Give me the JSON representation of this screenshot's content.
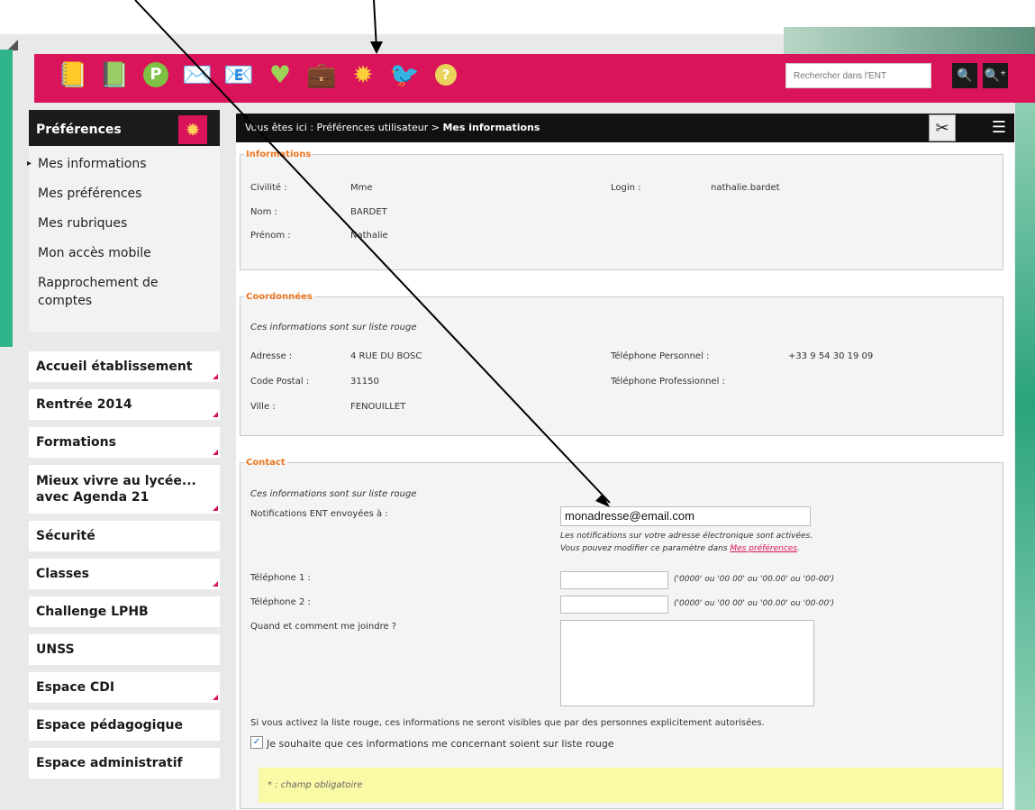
{
  "topbar": {
    "icons": [
      "notepad-icon",
      "book-icon",
      "p-icon",
      "mail-icon",
      "at-icon",
      "heart-icon",
      "briefcase-icon",
      "gear-icon",
      "bird-icon",
      "help-icon"
    ],
    "search_placeholder": "Rechercher dans l'ENT",
    "search_glyph": "🔍",
    "advanced_glyph": "🔍⁺"
  },
  "sidebar": {
    "pref_title": "Préférences",
    "pref_items": [
      "Mes informations",
      "Mes préférences",
      "Mes rubriques",
      "Mon accès mobile",
      "Rapprochement de comptes"
    ],
    "nav_items": [
      "Accueil établissement",
      "Rentrée 2014",
      "Formations",
      "Mieux vivre au lycée... avec Agenda 21",
      "Sécurité",
      "Classes",
      "Challenge LPHB",
      "UNSS",
      "Espace CDI",
      "Espace pédagogique",
      "Espace administratif"
    ]
  },
  "breadcrumb": {
    "prefix": "Vous êtes ici : Préférences utilisateur > ",
    "current": "Mes informations"
  },
  "informations": {
    "legend": "Informations",
    "civilite_label": "Civilité :",
    "civilite": "Mme",
    "nom_label": "Nom :",
    "nom": "BARDET",
    "prenom_label": "Prénom :",
    "prenom": "Nathalie",
    "login_label": "Login :",
    "login": "nathalie.bardet"
  },
  "coordonnees": {
    "legend": "Coordonnées",
    "note": "Ces informations sont sur liste rouge",
    "adresse_label": "Adresse :",
    "adresse": "4 RUE DU BOSC",
    "cp_label": "Code Postal :",
    "cp": "31150",
    "ville_label": "Ville :",
    "ville": "FENOUILLET",
    "tel_perso_label": "Téléphone Personnel :",
    "tel_perso": "+33 9 54 30 19 09",
    "tel_pro_label": "Téléphone Professionnel :"
  },
  "contact": {
    "legend": "Contact",
    "note": "Ces informations sont sur liste rouge",
    "notif_label": "Notifications ENT envoyées à :",
    "email": "monadresse@email.com",
    "notif_hint1": "Les notifications sur votre adresse électronique sont activées.",
    "notif_hint2_prefix": "Vous pouvez modifier ce paramètre dans ",
    "notif_hint2_link": "Mes préférences",
    "notif_hint2_suffix": ".",
    "tel1_label": "Téléphone 1 :",
    "tel2_label": "Téléphone 2 :",
    "tel_format": "('0000' ou '00 00' ou '00.00' ou '00-00')",
    "joindre_label": "Quand et comment me joindre ?",
    "liste_rouge_info": "Si vous activez la liste rouge, ces informations ne seront visibles que par des personnes explicitement autorisées.",
    "liste_rouge_checkbox": "Je souhaite que ces informations me concernant soient sur liste rouge"
  },
  "footer": {
    "mandatory": "* : champ obligatoire"
  }
}
